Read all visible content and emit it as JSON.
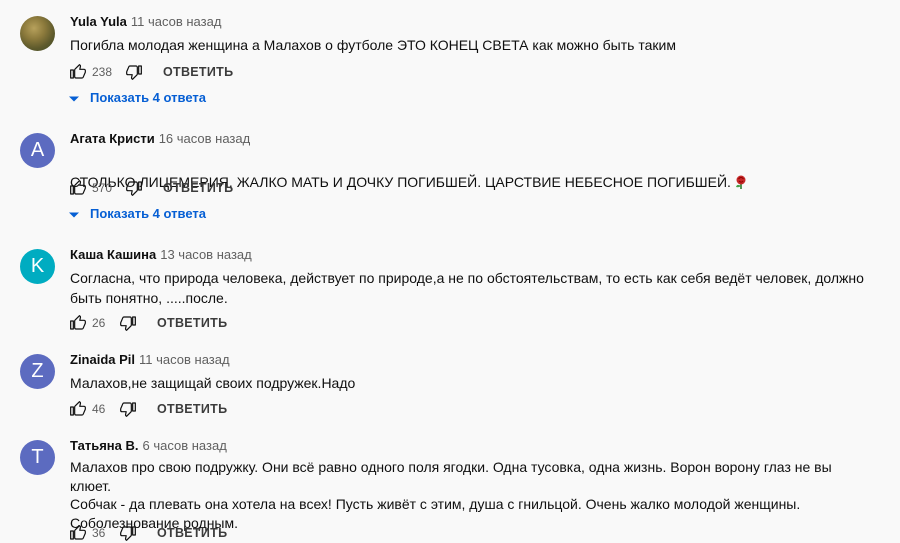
{
  "comments": [
    {
      "author": "Yula Yula",
      "time": "11 часов назад",
      "text": "Погибла молодая женщина а Малахов о футболе ЭТО КОНЕЦ СВЕТА как можно быть таким",
      "likes": "238",
      "reply_label": "ОТВЕТИТЬ",
      "replies_label": "Показать 4 ответа",
      "avatar_type": "photo"
    },
    {
      "author": "Агата Кристи",
      "time": "16 часов назад",
      "text": "СТОЛЬКО ЛИЦЕМЕРИЯ. ЖАЛКО МАТЬ И ДОЧКУ ПОГИБШЕЙ. ЦАРСТВИЕ НЕБЕСНОЕ ПОГИБШЕЙ.",
      "likes": "570",
      "reply_label": "ОТВЕТИТЬ",
      "replies_label": "Показать 4 ответа",
      "avatar_letter": "A",
      "avatar_color": "#5c6bc0",
      "text_emoji": "rose-icon"
    },
    {
      "author": "Каша Кашина",
      "time": "13 часов назад",
      "text": "Согласна, что природа человека, действует по природе,а не по обстоятельствам, то есть как себя ведёт человек, должно быть понятно, .....после.",
      "likes": "26",
      "reply_label": "ОТВЕТИТЬ",
      "avatar_letter": "K",
      "avatar_color": "#00acc1"
    },
    {
      "author": "Zinaida Pil",
      "time": "11 часов назад",
      "text": "Малахов,не защищай своих подружек.Надо",
      "likes": "46",
      "reply_label": "ОТВЕТИТЬ",
      "avatar_letter": "Z",
      "avatar_color": "#5c6bc0"
    },
    {
      "author": "Татьяна В.",
      "time": "6 часов назад",
      "text": "Малахов про свою подружку. Они всё равно одного поля ягодки. Одна тусовка, одна жизнь. Ворон ворону глаз не  вы клюет.\nСобчак -  да плевать она хотела на всех!  Пусть живёт с этим, душа с гнильцой.  Очень жалко молодой женщины.\nСоболезнование родным.",
      "likes": "36",
      "reply_label": "ОТВЕТИТЬ",
      "avatar_letter": "T",
      "avatar_color": "#5c6bc0"
    }
  ]
}
